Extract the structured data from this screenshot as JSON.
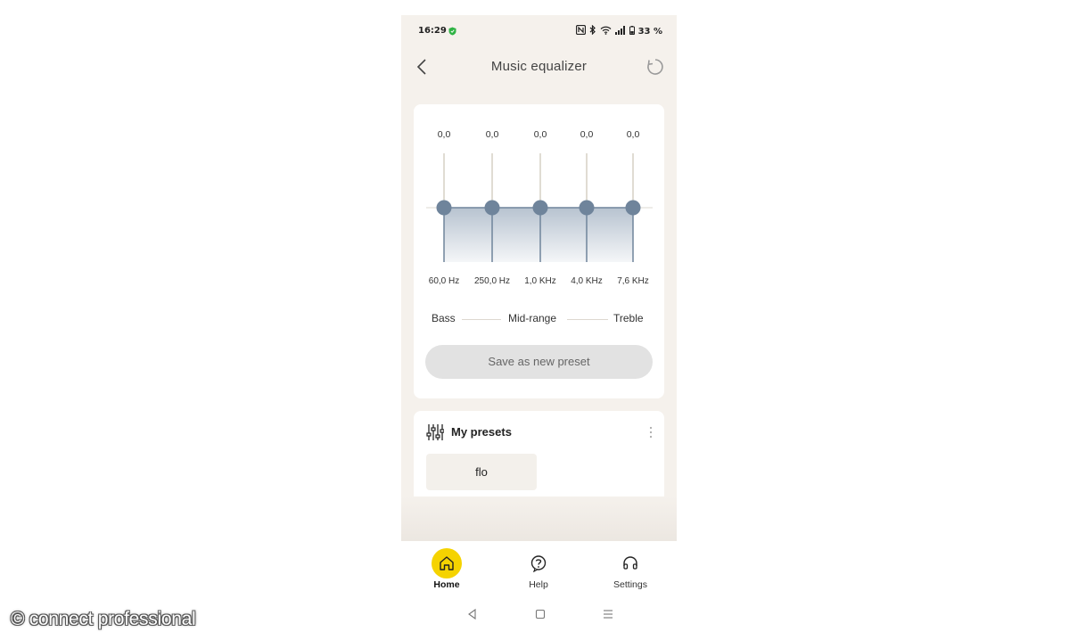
{
  "status_bar": {
    "time": "16:29",
    "battery": "33 %"
  },
  "header": {
    "title": "Music equalizer"
  },
  "equalizer": {
    "bands": [
      {
        "value": "0,0",
        "label": "60,0 Hz",
        "level": 0
      },
      {
        "value": "0,0",
        "label": "250,0 Hz",
        "level": 0
      },
      {
        "value": "0,0",
        "label": "1,0 KHz",
        "level": 0
      },
      {
        "value": "0,0",
        "label": "4,0 KHz",
        "level": 0
      },
      {
        "value": "0,0",
        "label": "7,6 KHz",
        "level": 0
      }
    ],
    "ranges": {
      "bass": "Bass",
      "mid": "Mid-range",
      "treble": "Treble"
    },
    "save_label": "Save as new preset"
  },
  "presets": {
    "title": "My presets",
    "items": [
      {
        "label": "flo"
      }
    ]
  },
  "bottom_nav": {
    "items": [
      {
        "label": "Home",
        "active": true
      },
      {
        "label": "Help",
        "active": false
      },
      {
        "label": "Settings",
        "active": false
      }
    ]
  },
  "colors": {
    "accent": "#f5d300",
    "eq_knob": "#6f849b",
    "eq_track": "#d5d0c4",
    "background": "#f5f1ec"
  },
  "watermark": "© connect professional"
}
